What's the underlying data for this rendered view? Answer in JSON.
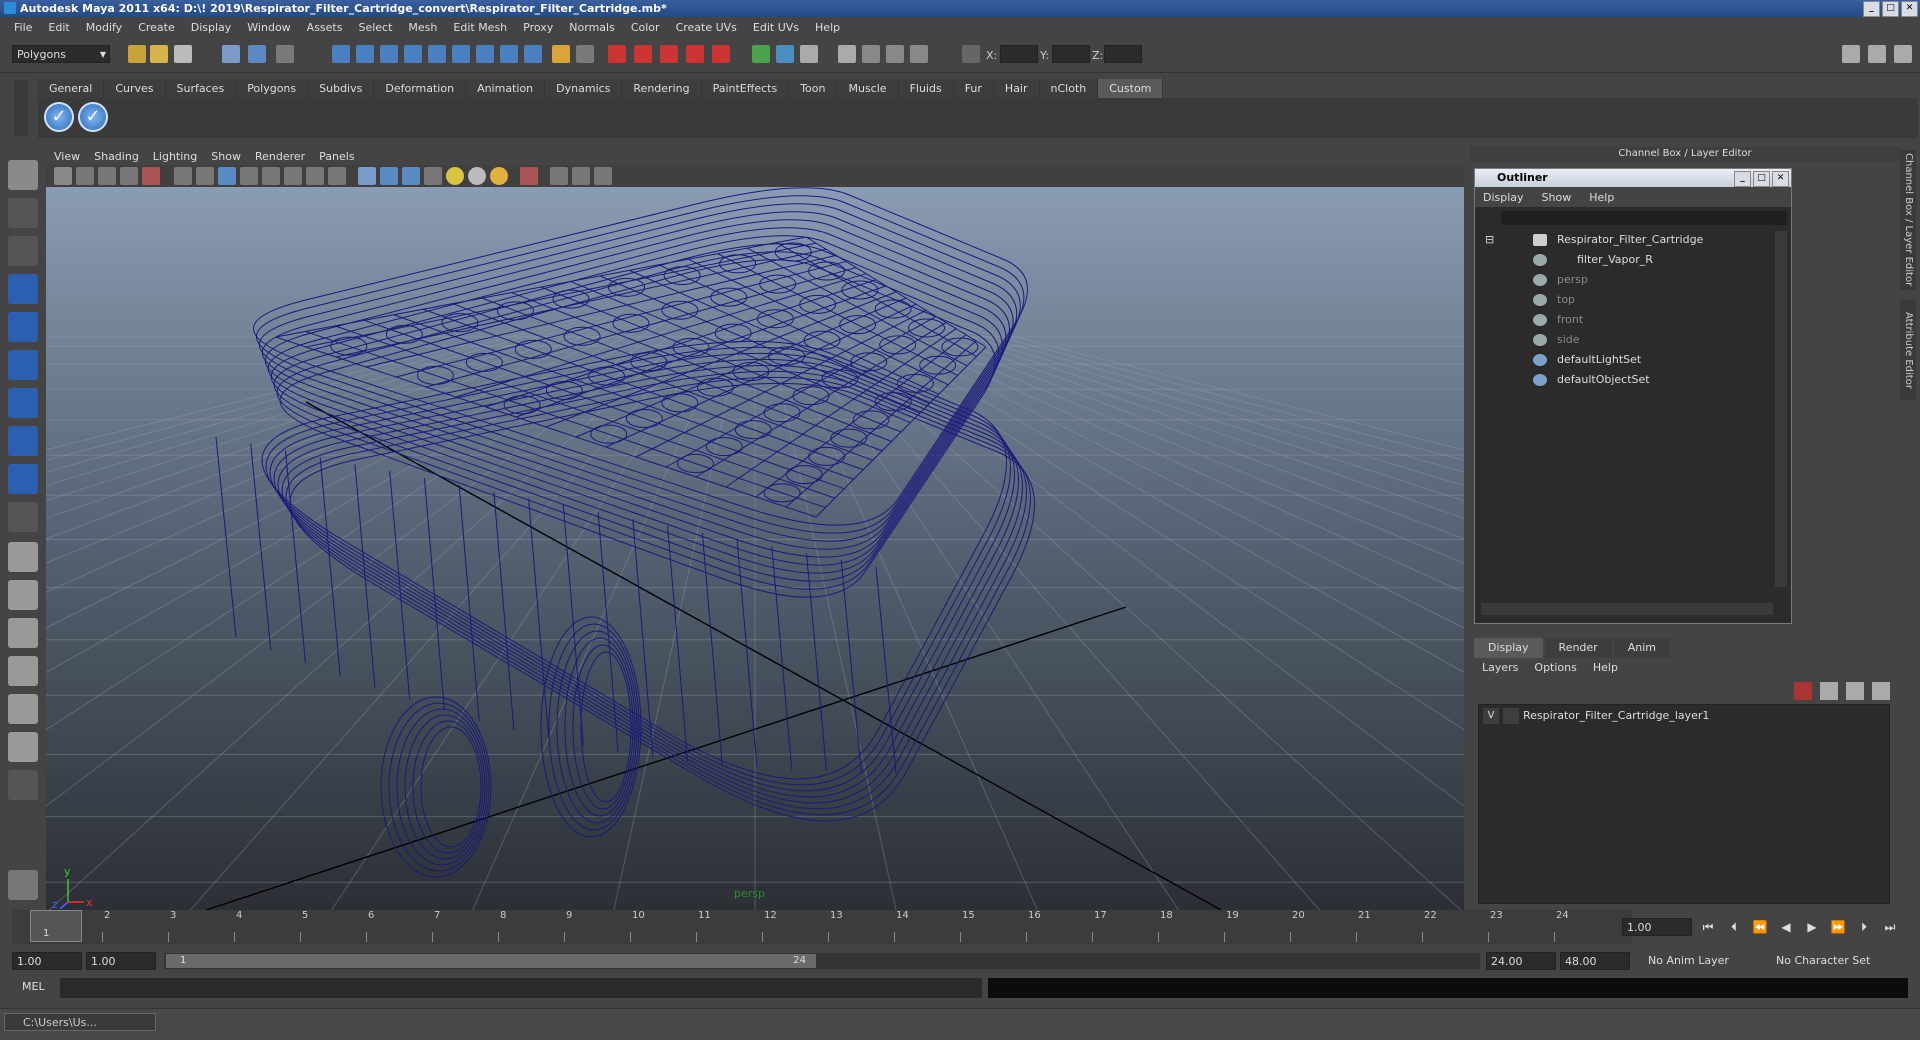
{
  "window": {
    "title": "Autodesk Maya 2011 x64: D:\\! 2019\\Respirator_Filter_Cartridge_convert\\Respirator_Filter_Cartridge.mb*",
    "buttons": [
      "_",
      "□",
      "✕"
    ]
  },
  "menubar": [
    "File",
    "Edit",
    "Modify",
    "Create",
    "Display",
    "Window",
    "Assets",
    "Select",
    "Mesh",
    "Edit Mesh",
    "Proxy",
    "Normals",
    "Color",
    "Create UVs",
    "Edit UVs",
    "Help"
  ],
  "statusline": {
    "mode": "Polygons",
    "x_label": "X:",
    "y_label": "Y:",
    "z_label": "Z:"
  },
  "shelf": {
    "tabs": [
      "General",
      "Curves",
      "Surfaces",
      "Polygons",
      "Subdivs",
      "Deformation",
      "Animation",
      "Dynamics",
      "Rendering",
      "PaintEffects",
      "Toon",
      "Muscle",
      "Fluids",
      "Fur",
      "Hair",
      "nCloth",
      "Custom"
    ],
    "active_tab": "Custom"
  },
  "viewport": {
    "menu": [
      "View",
      "Shading",
      "Lighting",
      "Show",
      "Renderer",
      "Panels"
    ],
    "camera": "persp",
    "axis_y": "y",
    "axis_x": "x",
    "axis_z": "z",
    "wire_color": "#1a1a7a"
  },
  "channel_box": {
    "header": "Channel Box / Layer Editor"
  },
  "outliner": {
    "title": "Outliner",
    "menu": [
      "Display",
      "Show",
      "Help"
    ],
    "items": [
      {
        "label": "Respirator_Filter_Cartridge",
        "dim": false
      },
      {
        "label": "filter_Vapor_R",
        "dim": false
      },
      {
        "label": "persp",
        "dim": true
      },
      {
        "label": "top",
        "dim": true
      },
      {
        "label": "front",
        "dim": true
      },
      {
        "label": "side",
        "dim": true
      },
      {
        "label": "defaultLightSet",
        "dim": false
      },
      {
        "label": "defaultObjectSet",
        "dim": false
      }
    ]
  },
  "layer_editor": {
    "tabs": [
      "Display",
      "Render",
      "Anim"
    ],
    "menu": [
      "Layers",
      "Options",
      "Help"
    ],
    "layer": {
      "visible": "V",
      "name": "Respirator_Filter_Cartridge_layer1"
    }
  },
  "side_tabs": [
    "Channel Box / Layer Editor",
    "Attribute Editor"
  ],
  "time_slider": {
    "ticks": [
      "1",
      "2",
      "3",
      "4",
      "5",
      "6",
      "7",
      "8",
      "9",
      "10",
      "11",
      "12",
      "13",
      "14",
      "15",
      "16",
      "17",
      "18",
      "19",
      "20",
      "21",
      "22",
      "23",
      "24"
    ],
    "current_frame": "1.00",
    "playhead_label": "1"
  },
  "range_slider": {
    "start": "1.00",
    "playback_start": "1.00",
    "thumb_start": "1",
    "thumb_end": "24",
    "playback_end": "24.00",
    "end": "48.00",
    "anim_layer": "No Anim Layer",
    "char_set": "No Character Set"
  },
  "command_line": {
    "label": "MEL"
  },
  "taskbar": {
    "item": "C:\\Users\\Us..."
  }
}
